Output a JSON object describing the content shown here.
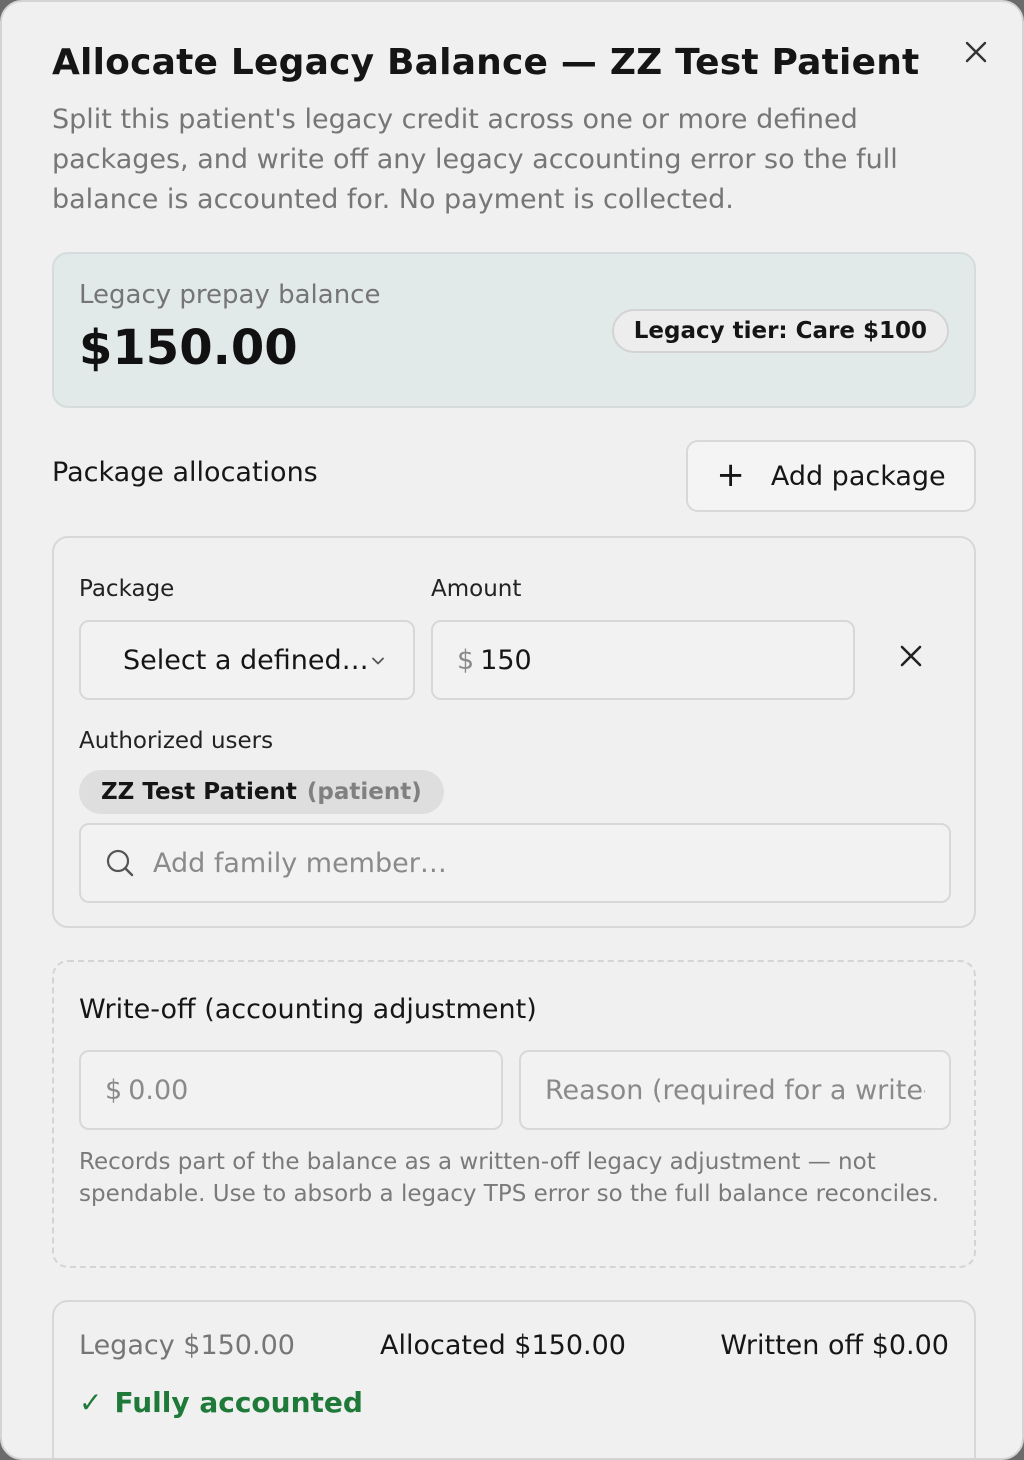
{
  "dialog": {
    "title": "Allocate Legacy Balance — ZZ Test Patient",
    "description": "Split this patient's legacy credit across one or more defined packages, and write off any legacy accounting error so the full balance is accounted for. No payment is collected.",
    "close_icon": "close-icon"
  },
  "balance": {
    "label": "Legacy prepay balance",
    "amount": "$150.00",
    "tier_badge": "Legacy tier: Care $100",
    "card_color": "#e2e9e9"
  },
  "allocations": {
    "section_label": "Package allocations",
    "add_button_icon": "plus-icon",
    "add_button_label": "Add package",
    "rows": [
      {
        "package_label": "Package",
        "package_selected": "Select a defined…",
        "amount_label": "Amount",
        "currency_symbol": "$",
        "amount_value": "150",
        "authorized_users_label": "Authorized users",
        "users": [
          {
            "name": "ZZ Test Patient",
            "role": "(patient)"
          }
        ],
        "family_search_placeholder": "Add family member…"
      }
    ]
  },
  "writeoff": {
    "title": "Write-off (accounting adjustment)",
    "currency_symbol": "$",
    "amount_placeholder": "0.00",
    "reason_placeholder": "Reason (required for a write-off)",
    "help_text": "Records part of the balance as a written-off legacy adjustment — not spendable. Use to absorb a legacy TPS error so the full balance reconciles."
  },
  "summary": {
    "legacy": "Legacy $150.00",
    "allocated": "Allocated $150.00",
    "written_off": "Written off $0.00",
    "status_icon": "✓",
    "status": "Fully accounted",
    "status_color": "#1f7a3a"
  }
}
